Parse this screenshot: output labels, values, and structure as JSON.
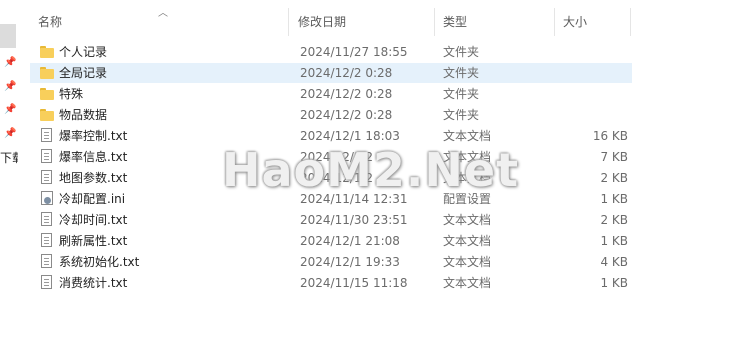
{
  "nav": {
    "partial_label": "下载"
  },
  "columns": {
    "name": "名称",
    "date": "修改日期",
    "type": "类型",
    "size": "大小"
  },
  "sort_icon": "chevron-up-icon",
  "files": [
    {
      "name": "个人记录",
      "date": "2024/11/27 18:55",
      "type": "文件夹",
      "size": "",
      "icon": "folder-icon",
      "selected": false
    },
    {
      "name": "全局记录",
      "date": "2024/12/2 0:28",
      "type": "文件夹",
      "size": "",
      "icon": "folder-icon",
      "selected": true
    },
    {
      "name": "特殊",
      "date": "2024/12/2 0:28",
      "type": "文件夹",
      "size": "",
      "icon": "folder-icon",
      "selected": false
    },
    {
      "name": "物品数据",
      "date": "2024/12/2 0:28",
      "type": "文件夹",
      "size": "",
      "icon": "folder-icon",
      "selected": false
    },
    {
      "name": "爆率控制.txt",
      "date": "2024/12/1 18:03",
      "type": "文本文档",
      "size": "16 KB",
      "icon": "text-file-icon",
      "selected": false
    },
    {
      "name": "爆率信息.txt",
      "date": "2024/12/1 2",
      "type": "文本文档",
      "size": "7 KB",
      "icon": "text-file-icon",
      "selected": false
    },
    {
      "name": "地图参数.txt",
      "date": "2024/12/1 2",
      "type": "文本文档",
      "size": "2 KB",
      "icon": "text-file-icon",
      "selected": false
    },
    {
      "name": "冷却配置.ini",
      "date": "2024/11/14 12:31",
      "type": "配置设置",
      "size": "1 KB",
      "icon": "config-file-icon",
      "selected": false
    },
    {
      "name": "冷却时间.txt",
      "date": "2024/11/30 23:51",
      "type": "文本文档",
      "size": "2 KB",
      "icon": "text-file-icon",
      "selected": false
    },
    {
      "name": "刷新属性.txt",
      "date": "2024/12/1 21:08",
      "type": "文本文档",
      "size": "1 KB",
      "icon": "text-file-icon",
      "selected": false
    },
    {
      "name": "系统初始化.txt",
      "date": "2024/12/1 19:33",
      "type": "文本文档",
      "size": "4 KB",
      "icon": "text-file-icon",
      "selected": false
    },
    {
      "name": "消费统计.txt",
      "date": "2024/11/15 11:18",
      "type": "文本文档",
      "size": "1 KB",
      "icon": "text-file-icon",
      "selected": false
    }
  ],
  "watermark": "HaoM2.Net"
}
